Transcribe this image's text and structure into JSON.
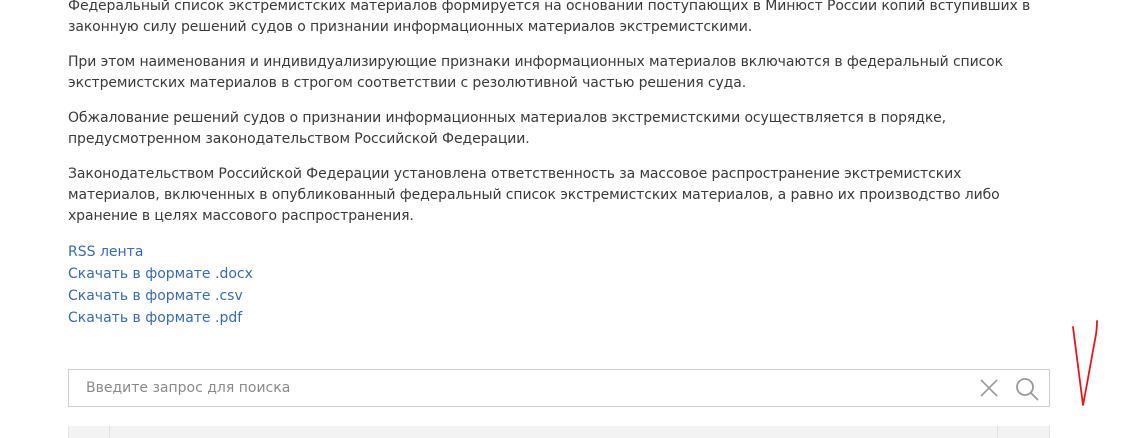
{
  "paragraphs": [
    "Федеральный список экстремистских материалов формируется на основании поступающих в Минюст России копий вступивших в законную силу решений судов о признании информационных материалов экстремистскими.",
    "При этом наименования и индивидуализирующие признаки информационных материалов включаются в федеральный список экстремистских материалов в строгом соответствии с резолютивной частью решения суда.",
    "Обжалование решений судов о признании информационных материалов экстремистскими осуществляется в порядке, предусмотренном законодательством Российской Федерации.",
    "Законодательством Российской Федерации установлена ответственность за массовое распространение экстремистских материалов, включенных в опубликованный федеральный список экстремистских материалов, а равно их производство либо хранение в целях массового распространения."
  ],
  "links": {
    "rss": "RSS лента",
    "docx": "Скачать в формате .docx",
    "csv": "Скачать в формате .csv",
    "pdf": "Скачать в формате .pdf"
  },
  "search": {
    "placeholder": "Введите запрос для поиска",
    "value": ""
  },
  "icons": {
    "clear": "close-icon",
    "search": "search-icon"
  },
  "colors": {
    "link": "#3a6ab3",
    "text": "#3a3a3a",
    "annotation": "#e0191d"
  }
}
